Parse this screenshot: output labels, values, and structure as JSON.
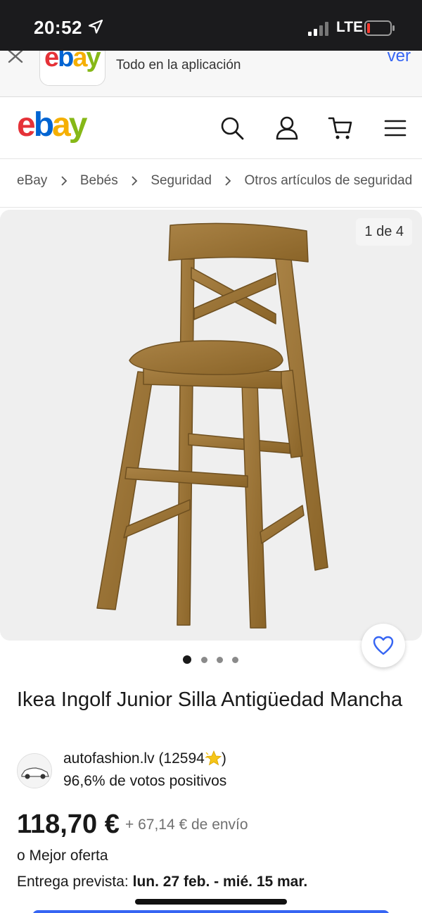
{
  "status_bar": {
    "time": "20:52",
    "network": "LTE"
  },
  "app_banner": {
    "text": "Todo en la aplicación",
    "open_label": "ver"
  },
  "header": {
    "logo": {
      "e": "e",
      "b": "b",
      "a": "a",
      "y": "y"
    }
  },
  "breadcrumb": [
    "eBay",
    "Bebés",
    "Seguridad",
    "Otros artículos de seguridad"
  ],
  "gallery": {
    "counter": "1 de 4",
    "dots": 4,
    "active_dot": 0
  },
  "product": {
    "title": "Ikea Ingolf Junior Silla Antigüedad Mancha",
    "seller_name": "autofashion.lv",
    "seller_score": "(12594",
    "seller_score_close": ")",
    "feedback": "96,6% de votos positivos",
    "price": "118,70 €",
    "shipping": "+ 67,14 € de envío",
    "best_offer": "o Mejor oferta",
    "delivery_label": "Entrega prevista:",
    "delivery_dates": "lun. 27 feb. - mié. 15 mar."
  },
  "colors": {
    "accent": "#3665f3",
    "ebay_red": "#e53238",
    "ebay_blue": "#0064d2",
    "ebay_yellow": "#f5af02",
    "ebay_green": "#86b817",
    "wood": "#9c7434"
  },
  "icons": [
    "location-arrow-icon",
    "signal-icon",
    "battery-icon",
    "close-icon",
    "search-icon",
    "user-icon",
    "cart-icon",
    "menu-icon",
    "chevron-right-icon",
    "heart-icon",
    "star-icon"
  ]
}
